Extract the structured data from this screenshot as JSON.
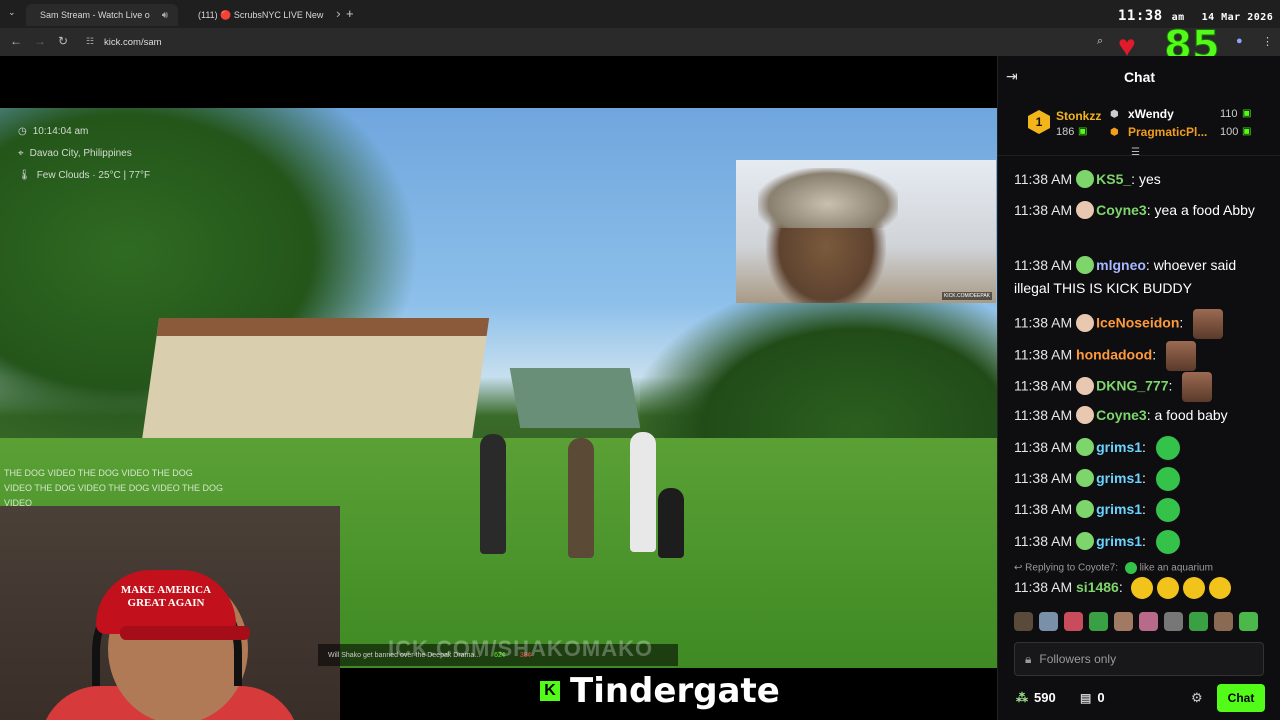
{
  "browser": {
    "tabs": [
      {
        "label": "Sam Stream - Watch Live o",
        "favicon": "kick-k-icon"
      },
      {
        "label": "(111) 🔴 ScrubsNYC LIVE New",
        "favicon": "youtube-icon"
      }
    ],
    "url": "kick.com/sam"
  },
  "overlay": {
    "time": "11:38",
    "ampm": "am",
    "date": "14 Mar 2026",
    "heart_rate": "85"
  },
  "stream": {
    "geo_time": "10:14:04 am",
    "geo_place": "Davao City, Philippines",
    "geo_weather": "Few Clouds · 25°C | 77°F",
    "pip_tag": "KICK.COM/DEEPAK",
    "overlay_chat": [
      "THE DOG VIDEO   THE DOG VIDEO   THE DOG",
      "VIDEO   THE DOG VIDEO   THE DOG VIDEO   THE DOG",
      "VIDEO"
    ],
    "cap_text": [
      "MAKE AMERICA",
      "GREAT AGAIN"
    ],
    "ticker_items": [
      "Will Shako get banned over the Deepak Drama...",
      "62¢",
      "38¢"
    ],
    "ticker_big": "ICK.COM/SHAKOMAKO",
    "caption": "Tindergate"
  },
  "chat": {
    "title": "Chat",
    "leaderboard": [
      {
        "rank": "1",
        "name": "Stonkzz",
        "value": "186"
      },
      {
        "name": "xWendy",
        "value": "110"
      },
      {
        "name": "PragmaticPl...",
        "value": "100"
      }
    ],
    "messages": [
      {
        "time": "11:38 AM",
        "user": "KS5_",
        "color": "#7ed56b",
        "text": "yes"
      },
      {
        "time": "11:38 AM",
        "user": "Coyne3",
        "color": "#7ed56b",
        "text": "yea a food Abby"
      },
      {
        "time": "11:38 AM",
        "user": "mlgneo",
        "color": "#a6b7ff",
        "text": "whoever said illegal THIS IS KICK BUDDY"
      },
      {
        "time": "11:38 AM",
        "user": "IceNoseidon",
        "color": "#ff9a3c",
        "text": ""
      },
      {
        "time": "11:38 AM",
        "user": "hondadood",
        "color": "#ff9a3c",
        "text": ""
      },
      {
        "time": "11:38 AM",
        "user": "DKNG_777",
        "color": "#7ed56b",
        "text": ""
      },
      {
        "time": "11:38 AM",
        "user": "Coyne3",
        "color": "#7ed56b",
        "text": "a food baby"
      },
      {
        "time": "11:38 AM",
        "user": "grims1",
        "color": "#6ad4ff",
        "text": ""
      },
      {
        "time": "11:38 AM",
        "user": "grims1",
        "color": "#6ad4ff",
        "text": ""
      },
      {
        "time": "11:38 AM",
        "user": "grims1",
        "color": "#6ad4ff",
        "text": ""
      },
      {
        "time": "11:38 AM",
        "user": "grims1",
        "color": "#6ad4ff",
        "text": ""
      }
    ],
    "reply_note": "Replying to Coyote7:",
    "reply_quote": "like an aquarium",
    "last_msg": {
      "time": "11:38 AM",
      "user": "si1486",
      "color": "#7ed56b"
    },
    "input_placeholder": "Followers only",
    "footer_points": "590",
    "footer_count": "0",
    "chat_button": "Chat"
  }
}
